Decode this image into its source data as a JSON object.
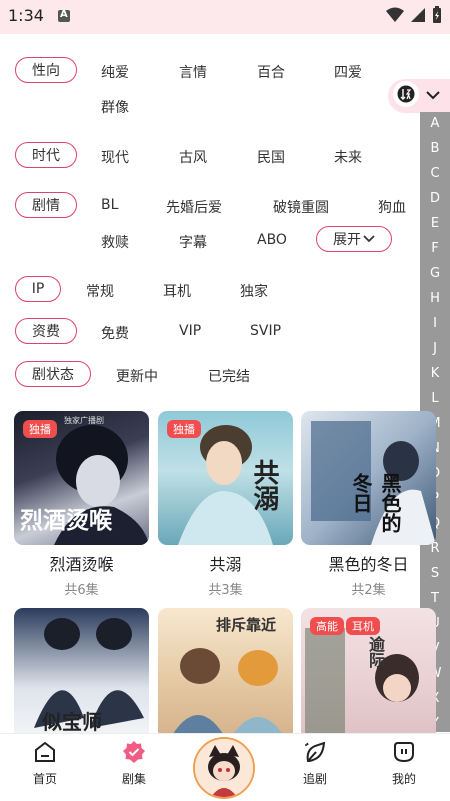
{
  "status_bar": {
    "time": "1:34"
  },
  "filters": {
    "orientation": {
      "label": "性向",
      "options": [
        "纯爱",
        "言情",
        "百合",
        "四爱",
        "群像"
      ]
    },
    "era": {
      "label": "时代",
      "options": [
        "现代",
        "古风",
        "民国",
        "未来"
      ]
    },
    "plot": {
      "label": "剧情",
      "options": [
        "BL",
        "先婚后爱",
        "破镜重圆",
        "狗血",
        "救赎",
        "字幕",
        "ABO"
      ],
      "expand_label": "展开"
    },
    "ip": {
      "label": "IP",
      "options": [
        "常规",
        "耳机",
        "独家"
      ]
    },
    "fee": {
      "label": "资费",
      "options": [
        "免费",
        "VIP",
        "SVIP"
      ]
    },
    "status": {
      "label": "剧状态",
      "options": [
        "更新中",
        "已完结"
      ]
    }
  },
  "index_letters": [
    "A",
    "B",
    "C",
    "D",
    "E",
    "F",
    "G",
    "H",
    "I",
    "J",
    "K",
    "L",
    "M",
    "N",
    "O",
    "P",
    "Q",
    "R",
    "S",
    "T",
    "U",
    "V",
    "W",
    "X",
    "Y"
  ],
  "dramas": [
    {
      "title": "烈酒烫喉",
      "episodes": "共6集",
      "badges": [
        "独播"
      ],
      "cover_text": "烈酒烫喉",
      "cover_top_text": "独家广播剧"
    },
    {
      "title": "共溺",
      "episodes": "共3集",
      "badges": [
        "独播"
      ],
      "cover_text": "共溺"
    },
    {
      "title": "黑色的冬日",
      "episodes": "共2集",
      "badges": [],
      "cover_text": "黑色的冬日"
    },
    {
      "title": "",
      "episodes": "",
      "badges": [],
      "cover_text": "似宝师"
    },
    {
      "title": "",
      "episodes": "",
      "badges": [],
      "cover_text": "排斥靠近"
    },
    {
      "title": "",
      "episodes": "",
      "badges": [
        "高能",
        "耳机"
      ],
      "cover_text": "逾际"
    }
  ],
  "bottom_nav": [
    {
      "label": "首页",
      "icon": "home-icon"
    },
    {
      "label": "剧集",
      "icon": "drama-badge-icon"
    },
    {
      "label": "追剧",
      "icon": "follow-leaf-icon"
    },
    {
      "label": "我的",
      "icon": "profile-icon"
    }
  ],
  "colors": {
    "accent": "#e0426c",
    "status_bar_bg": "#fde8ec",
    "index_bar_bg": "#999999",
    "badge": "#f04e4e"
  }
}
